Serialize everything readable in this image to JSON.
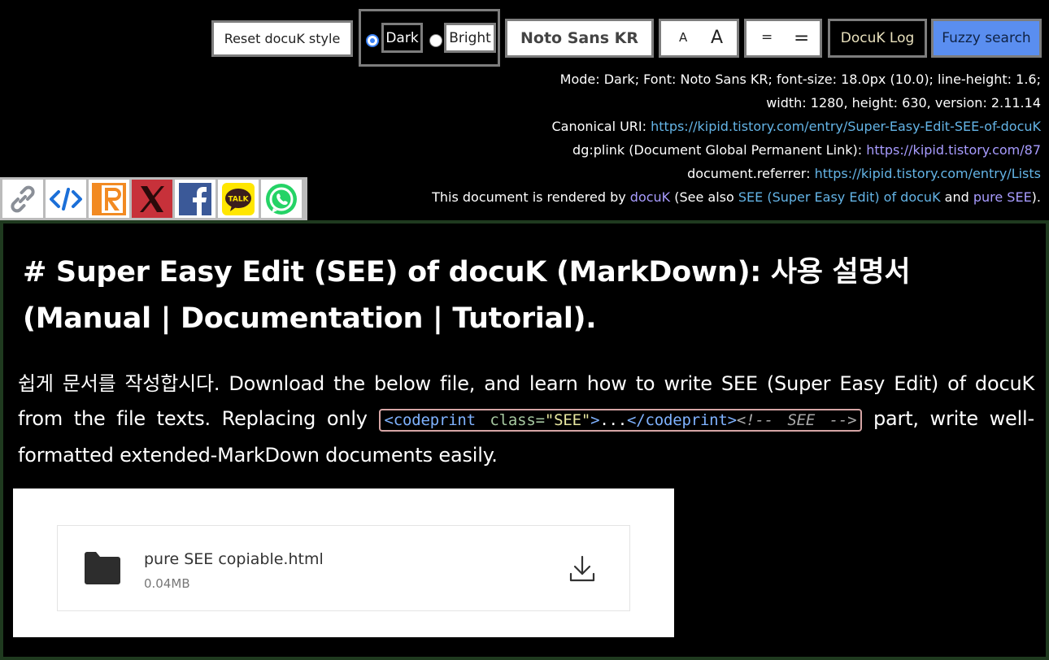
{
  "controls": {
    "reset_label": "Reset docuK style",
    "mode_dark_label": "Dark",
    "mode_bright_label": "Bright",
    "mode_selected": "Dark",
    "font_label": "Noto Sans KR",
    "font_small_label": "A",
    "font_large_label": "A",
    "line_small_label": "=",
    "line_large_label": "=",
    "log_label": "DocuK Log",
    "fuzzy_label": "Fuzzy search"
  },
  "info": {
    "line1": "Mode: Dark; Font: Noto Sans KR; font-size: 18.0px (10.0); line-height: 1.6;",
    "line2": "width: 1280, height: 630, version: 2.11.14",
    "canonical_label": "Canonical URI: ",
    "canonical_url": "https://kipid.tistory.com/entry/Super-Easy-Edit-SEE-of-docuK",
    "plink_label": "dg:plink (Document Global Permanent Link): ",
    "plink_url": "https://kipid.tistory.com/87",
    "referrer_label": "document.referrer: ",
    "referrer_url": "https://kipid.tistory.com/entry/Lists",
    "rendered_prefix": "This document is rendered by ",
    "rendered_docuk": "docuK",
    "rendered_mid": " (See also ",
    "rendered_see": "SEE (Super Easy Edit) of docuK",
    "rendered_and": " and ",
    "rendered_pure": "pure SEE",
    "rendered_suffix": ")."
  },
  "share_icons": [
    "link-icon",
    "code-icon",
    "reddit-r-icon",
    "x-icon",
    "facebook-icon",
    "kakao-talk-icon",
    "whatsapp-icon"
  ],
  "share": {
    "kakao_text": "TALK"
  },
  "document": {
    "title": "# Super Easy Edit (SEE) of docuK (MarkDown): 사용 설명서 (Manual | Documentation | Tutorial).",
    "para_before": "쉽게 문서를 작성합시다. Download the below file, and learn how to write SEE (Super Easy Edit) of docuK from the file texts. Replacing only ",
    "code": {
      "open": "<codeprint",
      "attr": " class=",
      "str": "\"SEE\"",
      "close_open": ">",
      "dots": "...",
      "end_tag": "</codeprint>",
      "comment": "<!-- SEE -->"
    },
    "para_after": " part, write well-formatted extended-MarkDown documents easily."
  },
  "file": {
    "name": "pure SEE copiable.html",
    "size": "0.04MB"
  },
  "colors": {
    "background": "#000000",
    "link": "#64b4e6",
    "visited_link": "#a89cff",
    "fuzzy_button": "#5a8ef0",
    "doc_border": "#1f3a1f"
  }
}
